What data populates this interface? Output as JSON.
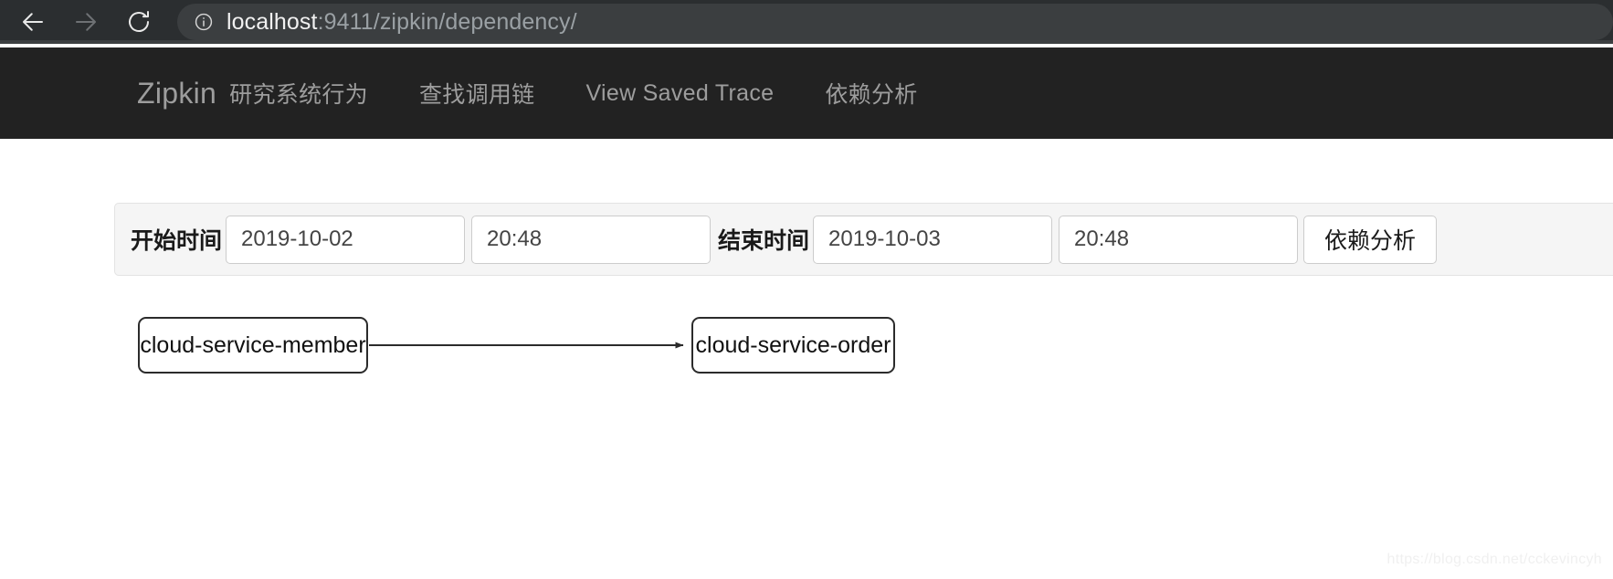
{
  "browser": {
    "back_icon": "arrow-left-icon",
    "forward_icon": "arrow-right-icon",
    "reload_icon": "reload-icon",
    "site_info_icon": "info-circle-icon",
    "url_host": "localhost",
    "url_path": ":9411/zipkin/dependency/",
    "url_full": "localhost:9411/zipkin/dependency/",
    "chrome_bg": "#2b2e30",
    "omnibox_bg": "#3b3e40"
  },
  "navbar": {
    "brand": "Zipkin",
    "bg": "#222222",
    "text_color": "#9d9d9d",
    "items": [
      {
        "label": "研究系统行为",
        "name": "nav-link-behavior"
      },
      {
        "label": "查找调用链",
        "name": "nav-link-find"
      },
      {
        "label": "View Saved Trace",
        "name": "nav-link-saved"
      },
      {
        "label": "依赖分析",
        "name": "nav-link-dependency"
      }
    ]
  },
  "query_form": {
    "panel_bg": "#f5f5f5",
    "start_label": "开始时间",
    "start_date": "2019-10-02",
    "start_time": "20:48",
    "end_label": "结束时间",
    "end_date": "2019-10-03",
    "end_time": "20:48",
    "submit_label": "依赖分析"
  },
  "dependency_graph": {
    "edge_color": "#2b2b2b",
    "node_border": "#2b2b2b",
    "nodes": [
      {
        "id": "cloud-service-member",
        "label": "cloud-service-member"
      },
      {
        "id": "cloud-service-order",
        "label": "cloud-service-order"
      }
    ],
    "edges": [
      {
        "from": "cloud-service-member",
        "to": "cloud-service-order"
      }
    ]
  },
  "watermark": {
    "text": "https://blog.csdn.net/cckevincyh"
  }
}
